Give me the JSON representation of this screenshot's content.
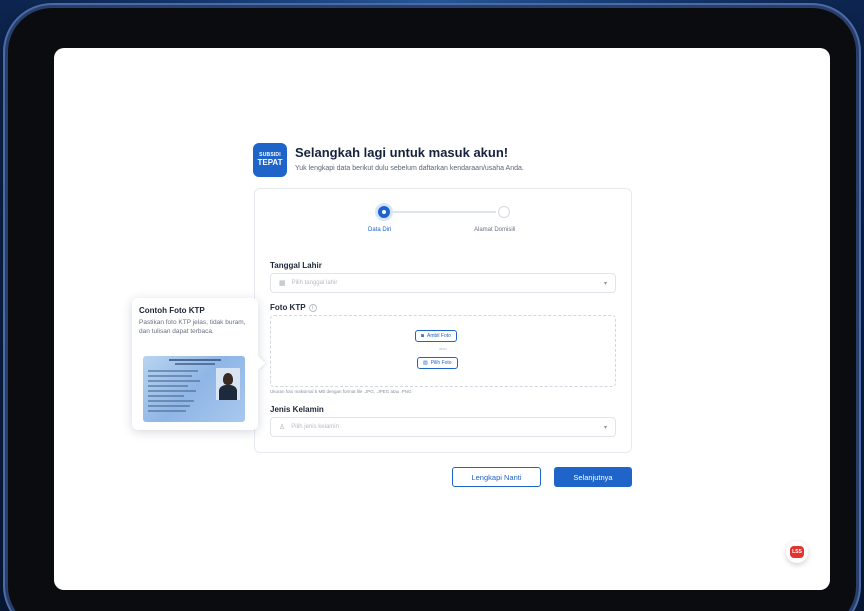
{
  "app": {
    "logo_line1": "SUBSIDI",
    "logo_line2": "TEPAT",
    "brand_color": "#1f64c8"
  },
  "header": {
    "title": "Selangkah lagi untuk masuk akun!",
    "subtitle": "Yuk lengkapi data berikut dulu sebelum daftarkan kendaraan/usaha Anda."
  },
  "stepper": {
    "steps": [
      {
        "label": "Data Diri",
        "active": true
      },
      {
        "label": "Alamat Domisili",
        "active": false
      }
    ]
  },
  "form": {
    "birthdate": {
      "label": "Tanggal Lahir",
      "placeholder": "Pilih tanggal lahir",
      "icon": "calendar-icon"
    },
    "ktp_photo": {
      "label": "Foto KTP",
      "take_photo_label": "Ambil Foto",
      "choose_photo_label": "Pilih Foto",
      "separator": "atau",
      "hint": "Ukuran foto maksimal 5 MB dengan format file .JPG, .JPEG atau .PNG"
    },
    "gender": {
      "label": "Jenis Kelamin",
      "placeholder": "Pilih jenis kelamin",
      "icon": "person-icon"
    }
  },
  "tooltip": {
    "title": "Contoh Foto KTP",
    "body": "Pastikan foto KTP jelas, tidak buram, dan tulisan dapat terbaca."
  },
  "actions": {
    "later_label": "Lengkapi Nanti",
    "next_label": "Selanjutnya"
  },
  "fab": {
    "label": "LSS",
    "color": "#e2342d"
  }
}
